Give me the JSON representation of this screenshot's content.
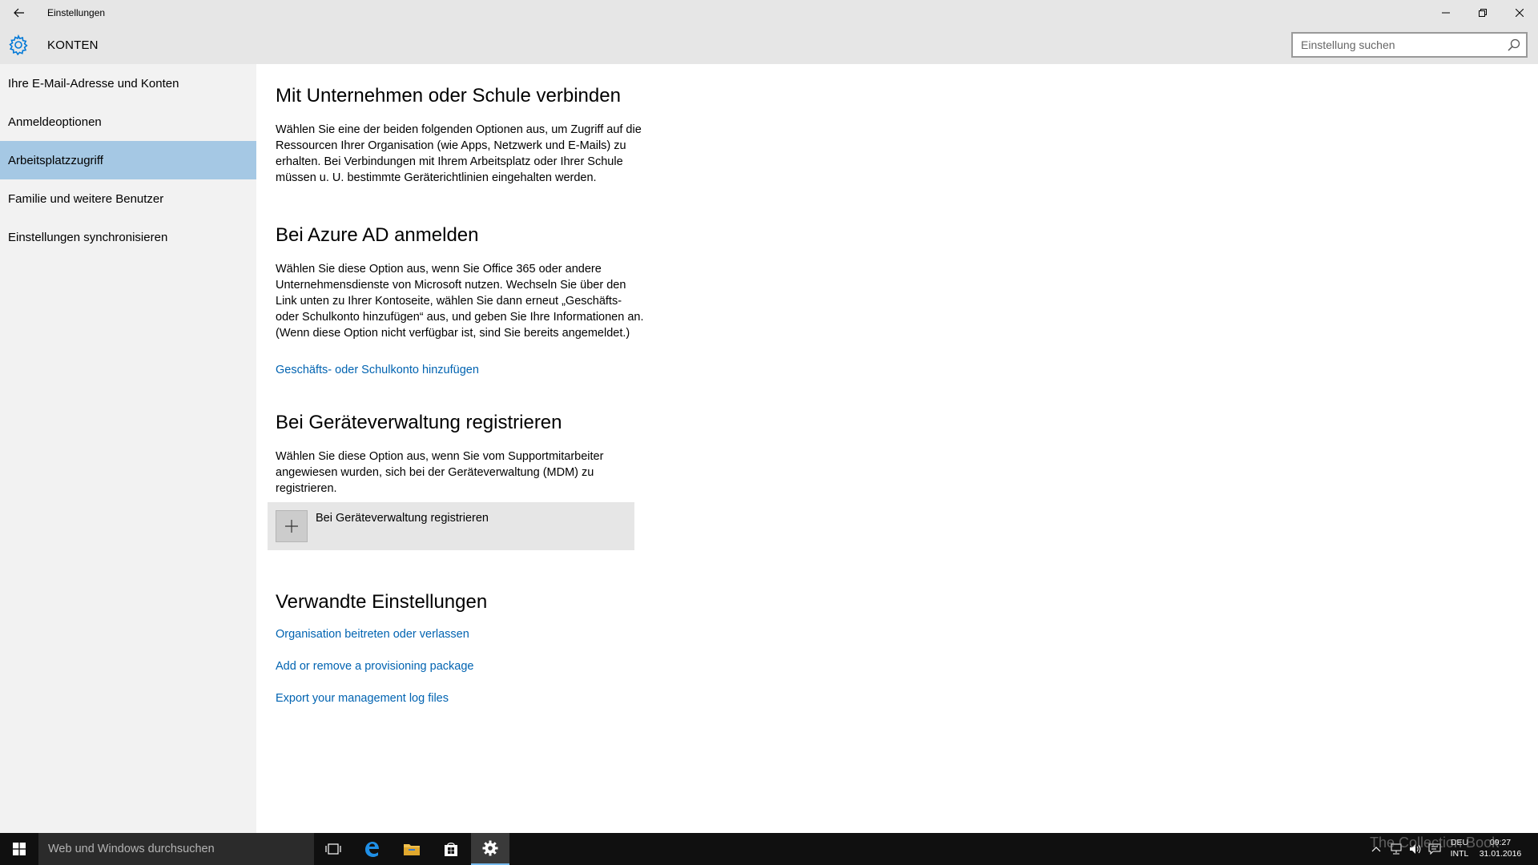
{
  "window": {
    "title": "Einstellungen"
  },
  "header": {
    "section_title": "KONTEN",
    "search_placeholder": "Einstellung suchen"
  },
  "sidebar": {
    "items": [
      {
        "label": "Ihre E-Mail-Adresse und Konten",
        "active": false
      },
      {
        "label": "Anmeldeoptionen",
        "active": false
      },
      {
        "label": "Arbeitsplatzzugriff",
        "active": true
      },
      {
        "label": "Familie und weitere Benutzer",
        "active": false
      },
      {
        "label": "Einstellungen synchronisieren",
        "active": false
      }
    ]
  },
  "main": {
    "section1": {
      "heading": "Mit Unternehmen oder Schule verbinden",
      "text": "Wählen Sie eine der beiden folgenden Optionen aus, um Zugriff auf die Ressourcen Ihrer Organisation (wie Apps, Netzwerk und E-Mails) zu erhalten. Bei Verbindungen mit Ihrem Arbeitsplatz oder Ihrer Schule müssen u. U. bestimmte Geräterichtlinien eingehalten werden."
    },
    "section2": {
      "heading": "Bei Azure AD anmelden",
      "text": "Wählen Sie diese Option aus, wenn Sie Office 365 oder andere Unternehmensdienste von Microsoft nutzen. Wechseln Sie über den Link unten zu Ihrer Kontoseite, wählen Sie dann erneut „Geschäfts- oder Schulkonto hinzufügen“ aus, und geben Sie Ihre Informationen an. (Wenn diese Option nicht verfügbar ist, sind Sie bereits angemeldet.)",
      "link": "Geschäfts- oder Schulkonto hinzufügen"
    },
    "section3": {
      "heading": "Bei Geräteverwaltung registrieren",
      "text": "Wählen Sie diese Option aus, wenn Sie vom Supportmitarbeiter angewiesen wurden, sich bei der Geräteverwaltung (MDM) zu registrieren.",
      "button_label": "Bei Geräteverwaltung registrieren"
    },
    "related": {
      "heading": "Verwandte Einstellungen",
      "links": [
        "Organisation beitreten oder verlassen",
        "Add or remove a provisioning package",
        "Export your management log files"
      ]
    }
  },
  "taskbar": {
    "search_placeholder": "Web und Windows durchsuchen",
    "language": [
      "DEU",
      "INTL"
    ],
    "time": "09:27",
    "date": "31.01.2016",
    "watermark": "The Collection Book"
  },
  "colors": {
    "link": "#0063b1",
    "active_nav": "#a5c8e4",
    "accent": "#0078d7",
    "taskbar": "#101010"
  },
  "icons": {
    "back": "back-arrow-icon",
    "minimize": "minimize-icon",
    "maximize": "restore-icon",
    "close": "close-icon",
    "settings": "gear-icon",
    "search": "search-icon",
    "add": "plus-icon",
    "start": "windows-logo-icon",
    "task_view": "task-view-icon",
    "edge": "edge-icon",
    "explorer": "folder-icon",
    "store": "store-icon",
    "settings_app": "settings-gear-icon"
  }
}
